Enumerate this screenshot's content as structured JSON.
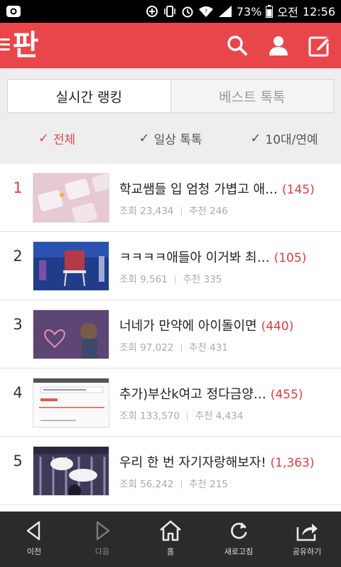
{
  "status_bar": {
    "battery": "73%",
    "ampm": "오전",
    "time": "12:56"
  },
  "header": {
    "logo_text": "판",
    "icons": [
      "menu-icon",
      "search-icon",
      "user-icon",
      "edit-icon"
    ],
    "accent_color": "#e9464c"
  },
  "tabs": [
    {
      "label": "실시간 랭킹",
      "active": true
    },
    {
      "label": "베스트 톡톡",
      "active": false
    }
  ],
  "filters": [
    {
      "label": "전체",
      "active": true
    },
    {
      "label": "일상 톡톡",
      "active": false
    },
    {
      "label": "10대/연예",
      "active": false
    }
  ],
  "posts": [
    {
      "rank": "1",
      "title": "학교쌤들 입 엄청 가볍고 애…",
      "comments": "(145)",
      "views_label": "조회",
      "views": "23,434",
      "likes_label": "추천",
      "likes": "246"
    },
    {
      "rank": "2",
      "title": "ㅋㅋㅋㅋ애들아 이거봐 최…",
      "comments": "(105)",
      "views_label": "조회",
      "views": "9,561",
      "likes_label": "추천",
      "likes": "335"
    },
    {
      "rank": "3",
      "title": "너네가 만약에 아이돌이면",
      "comments": "(440)",
      "views_label": "조회",
      "views": "97,022",
      "likes_label": "추천",
      "likes": "431"
    },
    {
      "rank": "4",
      "title": "추가)부산k여고 정다금양…",
      "comments": "(455)",
      "views_label": "조회",
      "views": "133,570",
      "likes_label": "추천",
      "likes": "4,434"
    },
    {
      "rank": "5",
      "title": "우리 한 번 자기자랑해보자!",
      "comments": "(1,363)",
      "views_label": "조회",
      "views": "56,242",
      "likes_label": "추천",
      "likes": "215"
    }
  ],
  "bottom_nav": [
    {
      "label": "이전",
      "icon": "back-icon"
    },
    {
      "label": "다음",
      "icon": "forward-icon"
    },
    {
      "label": "홈",
      "icon": "home-icon"
    },
    {
      "label": "새로고침",
      "icon": "refresh-icon"
    },
    {
      "label": "공유하기",
      "icon": "share-icon"
    }
  ]
}
